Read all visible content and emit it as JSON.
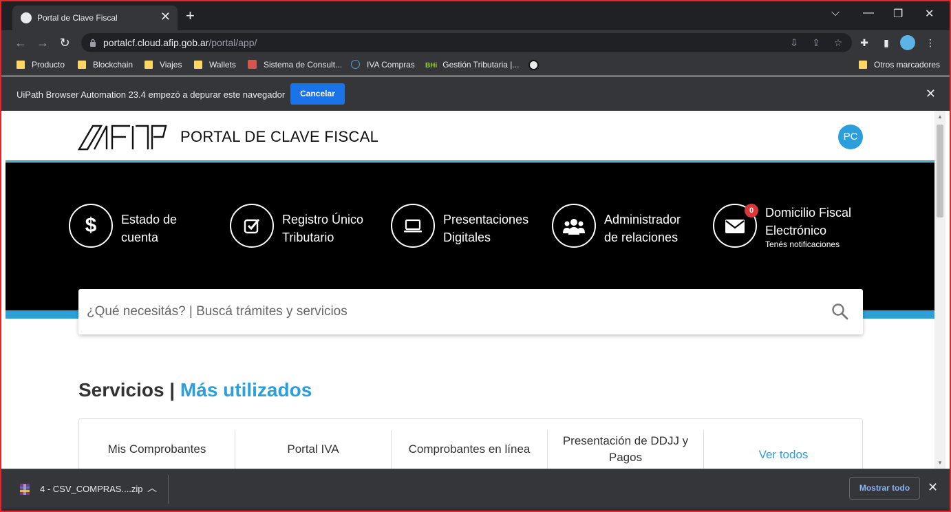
{
  "browser": {
    "tab": {
      "title": "Portal de Clave Fiscal",
      "close": "✕"
    },
    "new_tab": "+",
    "window_controls": {
      "tabsearch": "⌵",
      "minimize": "—",
      "maximize": "❐",
      "close": "✕"
    },
    "url": {
      "host": "portalcf.cloud.afip.gob.ar",
      "path": "/portal/app/"
    },
    "bookmarks": [
      {
        "label": "Producto",
        "icon": "folder-icon"
      },
      {
        "label": "Blockchain",
        "icon": "folder-icon"
      },
      {
        "label": "Viajes",
        "icon": "folder-icon"
      },
      {
        "label": "Wallets",
        "icon": "folder-icon"
      },
      {
        "label": "Sistema de Consult...",
        "icon": "search-doc-icon"
      },
      {
        "label": "IVA Compras",
        "icon": "globe-icon"
      },
      {
        "label": "Gestión Tributaria |...",
        "icon": "bhi-icon",
        "icon_text": "BHi"
      },
      {
        "label": "",
        "icon": "afip-icon"
      }
    ],
    "other_bookmarks": "Otros marcadores",
    "infobar": {
      "text": "UiPath Browser Automation 23.4 empezó a depurar este navegador",
      "cancel": "Cancelar"
    },
    "download": {
      "filename": "4 - CSV_COMPRAS....zip",
      "show_all": "Mostrar todo"
    }
  },
  "portal": {
    "title": "PORTAL DE CLAVE FISCAL",
    "user_initials": "PC",
    "features": [
      {
        "line1": "Estado de",
        "line2": "cuenta",
        "icon": "dollar-icon"
      },
      {
        "line1": "Registro Único",
        "line2": "Tributario",
        "icon": "checkbox-icon"
      },
      {
        "line1": "Presentaciones",
        "line2": "Digitales",
        "icon": "laptop-icon"
      },
      {
        "line1": "Administrador",
        "line2": "de relaciones",
        "icon": "users-icon"
      },
      {
        "line1": "Domicilio Fiscal",
        "line2": "Electrónico",
        "sub": "Tenés notificaciones",
        "badge": "0",
        "icon": "envelope-icon"
      }
    ],
    "search_placeholder": "¿Qué necesitás? | Buscá trámites y servicios",
    "services_title": "Servicios |",
    "services_accent": "Más utilizados",
    "services": [
      "Mis Comprobantes",
      "Portal IVA",
      "Comprobantes en línea",
      "Presentación de DDJJ y Pagos"
    ],
    "ver_todos": "Ver todos"
  },
  "colors": {
    "accent": "#2a9fdc",
    "chrome_dark": "#35363a",
    "badge": "#d9373b",
    "button_blue": "#1a73e8"
  }
}
